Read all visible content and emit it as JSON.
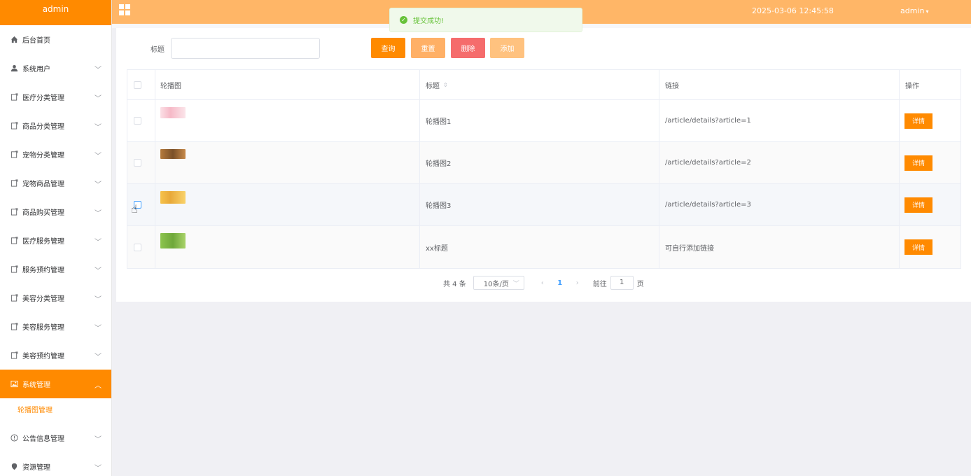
{
  "sidebar": {
    "brand": "admin",
    "items": [
      {
        "label": "后台首页",
        "icon": "home-icon",
        "chevron": false
      },
      {
        "label": "系统用户",
        "icon": "user-icon",
        "chevron": true
      },
      {
        "label": "医疗分类管理",
        "icon": "doc-icon",
        "chevron": true
      },
      {
        "label": "商品分类管理",
        "icon": "doc-icon",
        "chevron": true
      },
      {
        "label": "宠物分类管理",
        "icon": "doc-icon",
        "chevron": true
      },
      {
        "label": "宠物商品管理",
        "icon": "doc-icon",
        "chevron": true
      },
      {
        "label": "商品购买管理",
        "icon": "doc-icon",
        "chevron": true
      },
      {
        "label": "医疗服务管理",
        "icon": "doc-icon",
        "chevron": true
      },
      {
        "label": "服务预约管理",
        "icon": "doc-icon",
        "chevron": true
      },
      {
        "label": "美容分类管理",
        "icon": "doc-icon",
        "chevron": true
      },
      {
        "label": "美容服务管理",
        "icon": "doc-icon",
        "chevron": true
      },
      {
        "label": "美容预约管理",
        "icon": "doc-icon",
        "chevron": true
      },
      {
        "label": "系统管理",
        "icon": "picture-icon",
        "chevron": true,
        "active": true
      },
      {
        "label": "公告信息管理",
        "icon": "info-icon",
        "chevron": true
      },
      {
        "label": "资源管理",
        "icon": "location-icon",
        "chevron": true
      }
    ],
    "submenu": {
      "label": "轮播图管理"
    }
  },
  "header": {
    "datetime": "2025-03-06 12:45:58",
    "user": "admin"
  },
  "toast": {
    "message": "提交成功!"
  },
  "search": {
    "label": "标题",
    "value": "",
    "buttons": {
      "query": "查询",
      "reset": "重置",
      "delete": "删除",
      "add": "添加"
    }
  },
  "table": {
    "columns": {
      "image": "轮播图",
      "title": "标题",
      "link": "链接",
      "op": "操作"
    },
    "rows": [
      {
        "title": "轮播图1",
        "link": "/article/details?article=1",
        "action": "详情"
      },
      {
        "title": "轮播图2",
        "link": "/article/details?article=2",
        "action": "详情"
      },
      {
        "title": "轮播图3",
        "link": "/article/details?article=3",
        "action": "详情"
      },
      {
        "title": "xx标题",
        "link": "可自行添加链接",
        "action": "详情"
      }
    ]
  },
  "pagination": {
    "total": "共 4 条",
    "page_size": "10条/页",
    "current_page": "1",
    "goto_label": "前往",
    "goto_value": "1",
    "page_suffix": "页"
  },
  "colors": {
    "accent": "#ff8a00",
    "header": "#ffb667",
    "danger": "#f56c6c",
    "success": "#67c23a"
  }
}
